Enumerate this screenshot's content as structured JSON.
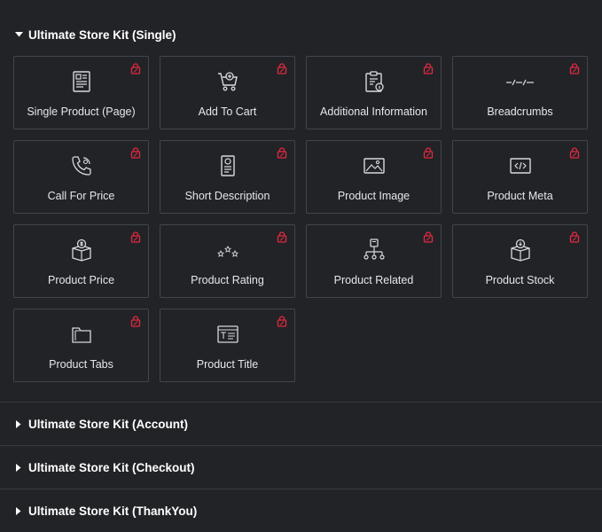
{
  "sections": [
    {
      "title": "Ultimate Store Kit (Single)",
      "expanded": true
    },
    {
      "title": "Ultimate Store Kit (Account)",
      "expanded": false
    },
    {
      "title": "Ultimate Store Kit (Checkout)",
      "expanded": false
    },
    {
      "title": "Ultimate Store Kit (ThankYou)",
      "expanded": false
    }
  ],
  "widgets": [
    {
      "label": "Single Product (Page)",
      "icon": "single-product-icon",
      "locked": true
    },
    {
      "label": "Add To Cart",
      "icon": "add-to-cart-icon",
      "locked": true
    },
    {
      "label": "Additional Information",
      "icon": "additional-information-icon",
      "locked": true
    },
    {
      "label": "Breadcrumbs",
      "icon": "breadcrumbs-icon",
      "locked": true
    },
    {
      "label": "Call For Price",
      "icon": "call-for-price-icon",
      "locked": true
    },
    {
      "label": "Short Description",
      "icon": "short-description-icon",
      "locked": true
    },
    {
      "label": "Product Image",
      "icon": "product-image-icon",
      "locked": true
    },
    {
      "label": "Product Meta",
      "icon": "product-meta-icon",
      "locked": true
    },
    {
      "label": "Product Price",
      "icon": "product-price-icon",
      "locked": true
    },
    {
      "label": "Product Rating",
      "icon": "product-rating-icon",
      "locked": true
    },
    {
      "label": "Product Related",
      "icon": "product-related-icon",
      "locked": true
    },
    {
      "label": "Product Stock",
      "icon": "product-stock-icon",
      "locked": true
    },
    {
      "label": "Product Tabs",
      "icon": "product-tabs-icon",
      "locked": true
    },
    {
      "label": "Product Title",
      "icon": "product-title-icon",
      "locked": true
    }
  ],
  "colors": {
    "background": "#222327",
    "tile_border": "#44454b",
    "lock": "#e2293f",
    "icon": "#d8d9dc"
  }
}
